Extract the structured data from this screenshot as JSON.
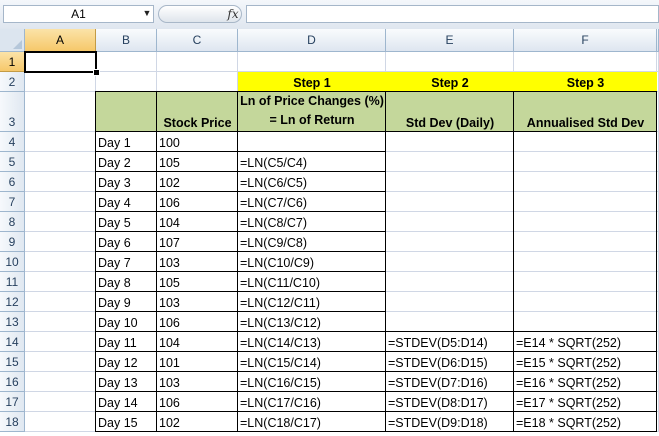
{
  "formula_bar": {
    "name_box": "A1",
    "fx_label": "fx",
    "formula": ""
  },
  "columns": [
    {
      "id": "A",
      "label": "A",
      "w": 71,
      "selected": true
    },
    {
      "id": "B",
      "label": "B",
      "w": 61,
      "selected": false
    },
    {
      "id": "C",
      "label": "C",
      "w": 81,
      "selected": false
    },
    {
      "id": "D",
      "label": "D",
      "w": 148,
      "selected": false
    },
    {
      "id": "E",
      "label": "E",
      "w": 128,
      "selected": false
    },
    {
      "id": "F",
      "label": "F",
      "w": 143,
      "selected": false
    }
  ],
  "rows": [
    {
      "label": "1",
      "h": 20,
      "selected": true
    },
    {
      "label": "2",
      "h": 20,
      "selected": false
    },
    {
      "label": "3",
      "h": 40,
      "selected": false
    },
    {
      "label": "4",
      "h": 20,
      "selected": false
    },
    {
      "label": "5",
      "h": 20,
      "selected": false
    },
    {
      "label": "6",
      "h": 20,
      "selected": false
    },
    {
      "label": "7",
      "h": 20,
      "selected": false
    },
    {
      "label": "8",
      "h": 20,
      "selected": false
    },
    {
      "label": "9",
      "h": 20,
      "selected": false
    },
    {
      "label": "10",
      "h": 20,
      "selected": false
    },
    {
      "label": "11",
      "h": 20,
      "selected": false
    },
    {
      "label": "12",
      "h": 20,
      "selected": false
    },
    {
      "label": "13",
      "h": 20,
      "selected": false
    },
    {
      "label": "14",
      "h": 20,
      "selected": false
    },
    {
      "label": "15",
      "h": 20,
      "selected": false
    },
    {
      "label": "16",
      "h": 20,
      "selected": false
    },
    {
      "label": "17",
      "h": 20,
      "selected": false
    },
    {
      "label": "18",
      "h": 20,
      "selected": false
    }
  ],
  "colors": {
    "header_green": "#c4d79b",
    "step_yellow": "#ffff00"
  },
  "steps": [
    "Step 1",
    "Step 2",
    "Step 3"
  ],
  "table_headers": {
    "stock_price": "Stock Price",
    "ln_line1": "Ln of Price Changes (%)",
    "ln_line2": "= Ln of Return",
    "std_dev": "Std Dev (Daily)",
    "annual": "Annualised Std Dev"
  },
  "days": [
    "Day 1",
    "Day 2",
    "Day 3",
    "Day 4",
    "Day 5",
    "Day 6",
    "Day 7",
    "Day 8",
    "Day 9",
    "Day 10",
    "Day 11",
    "Day 12",
    "Day 13",
    "Day 14",
    "Day 15"
  ],
  "prices": [
    "100",
    "105",
    "102",
    "106",
    "104",
    "107",
    "103",
    "105",
    "103",
    "106",
    "104",
    "101",
    "103",
    "106",
    "102"
  ],
  "ln_formulas": [
    "",
    "=LN(C5/C4)",
    "=LN(C6/C5)",
    "=LN(C7/C6)",
    "=LN(C8/C7)",
    "=LN(C9/C8)",
    "=LN(C10/C9)",
    "=LN(C11/C10)",
    "=LN(C12/C11)",
    "=LN(C13/C12)",
    "=LN(C14/C13)",
    "=LN(C15/C14)",
    "=LN(C16/C15)",
    "=LN(C17/C16)",
    "=LN(C18/C17)"
  ],
  "stdev_formulas": [
    "",
    "",
    "",
    "",
    "",
    "",
    "",
    "",
    "",
    "",
    "=STDEV(D5:D14)",
    "=STDEV(D6:D15)",
    "=STDEV(D7:D16)",
    "=STDEV(D8:D17)",
    "=STDEV(D9:D18)"
  ],
  "annual_formulas": [
    "",
    "",
    "",
    "",
    "",
    "",
    "",
    "",
    "",
    "",
    "=E14 * SQRT(252)",
    "=E15 * SQRT(252)",
    "=E16 * SQRT(252)",
    "=E17 * SQRT(252)",
    "=E18 * SQRT(252)"
  ]
}
